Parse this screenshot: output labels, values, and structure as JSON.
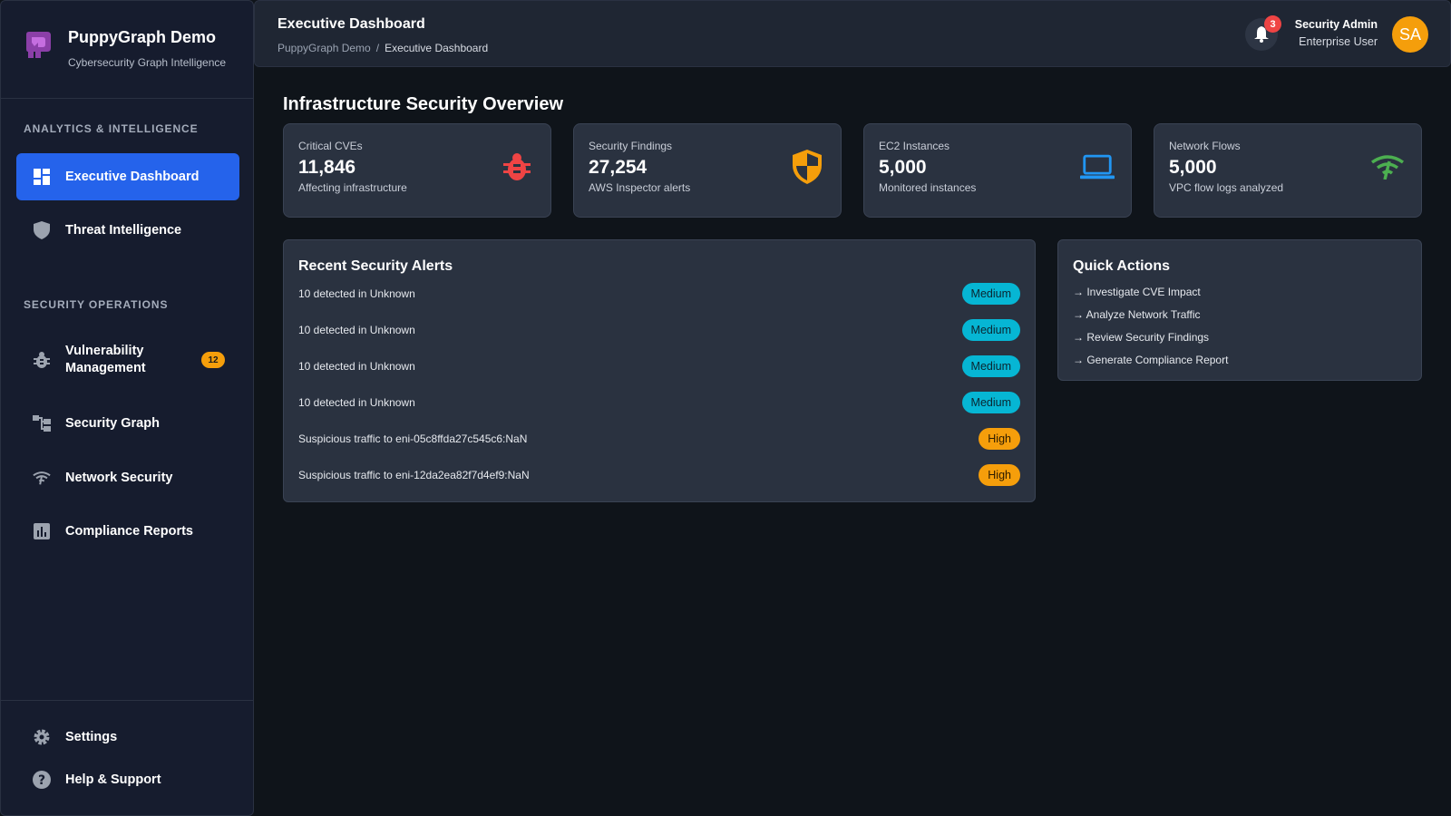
{
  "brand": {
    "title": "PuppyGraph Demo",
    "subtitle": "Cybersecurity Graph Intelligence"
  },
  "sidebar": {
    "sections": [
      {
        "label": "ANALYTICS & INTELLIGENCE"
      },
      {
        "label": "SECURITY OPERATIONS"
      }
    ],
    "items": [
      {
        "label": "Executive Dashboard",
        "icon": "dashboard-icon",
        "active": true
      },
      {
        "label": "Threat Intelligence",
        "icon": "shield-icon"
      },
      {
        "label": "Vulnerability Management",
        "icon": "bug-icon",
        "badge": "12"
      },
      {
        "label": "Security Graph",
        "icon": "graph-icon"
      },
      {
        "label": "Network Security",
        "icon": "wifi-icon"
      },
      {
        "label": "Compliance Reports",
        "icon": "bar-chart-icon"
      }
    ],
    "footer": [
      {
        "label": "Settings",
        "icon": "gear-icon"
      },
      {
        "label": "Help & Support",
        "icon": "help-icon"
      }
    ]
  },
  "header": {
    "title": "Executive Dashboard",
    "breadcrumb": [
      "PuppyGraph Demo",
      "/",
      "Executive Dashboard"
    ],
    "notifications": "3",
    "user": {
      "name": "Security Admin",
      "role": "Enterprise User",
      "initials": "SA"
    }
  },
  "main": {
    "title": "Infrastructure Security Overview",
    "stats": [
      {
        "label": "Critical CVEs",
        "value": "11,846",
        "sub": "Affecting infrastructure",
        "icon": "bug-icon",
        "color": "#ef4444"
      },
      {
        "label": "Security Findings",
        "value": "27,254",
        "sub": "AWS Inspector alerts",
        "icon": "shield-icon",
        "color": "#f59e0b"
      },
      {
        "label": "EC2 Instances",
        "value": "5,000",
        "sub": "Monitored instances",
        "icon": "laptop-icon",
        "color": "#2196f3"
      },
      {
        "label": "Network Flows",
        "value": "5,000",
        "sub": "VPC flow logs analyzed",
        "icon": "wifi-icon",
        "color": "#4caf50"
      }
    ],
    "alerts": {
      "title": "Recent Security Alerts",
      "rows": [
        {
          "text": "10 detected in Unknown",
          "severity": "Medium"
        },
        {
          "text": "10 detected in Unknown",
          "severity": "Medium"
        },
        {
          "text": "10 detected in Unknown",
          "severity": "Medium"
        },
        {
          "text": "10 detected in Unknown",
          "severity": "Medium"
        },
        {
          "text": "Suspicious traffic to eni-05c8ffda27c545c6:NaN",
          "severity": "High"
        },
        {
          "text": "Suspicious traffic to eni-12da2ea82f7d4ef9:NaN",
          "severity": "High"
        }
      ]
    },
    "quick_actions": {
      "title": "Quick Actions",
      "items": [
        "→ Investigate CVE Impact",
        "→ Analyze Network Traffic",
        "→ Review Security Findings",
        "→ Generate Compliance Report"
      ]
    }
  }
}
